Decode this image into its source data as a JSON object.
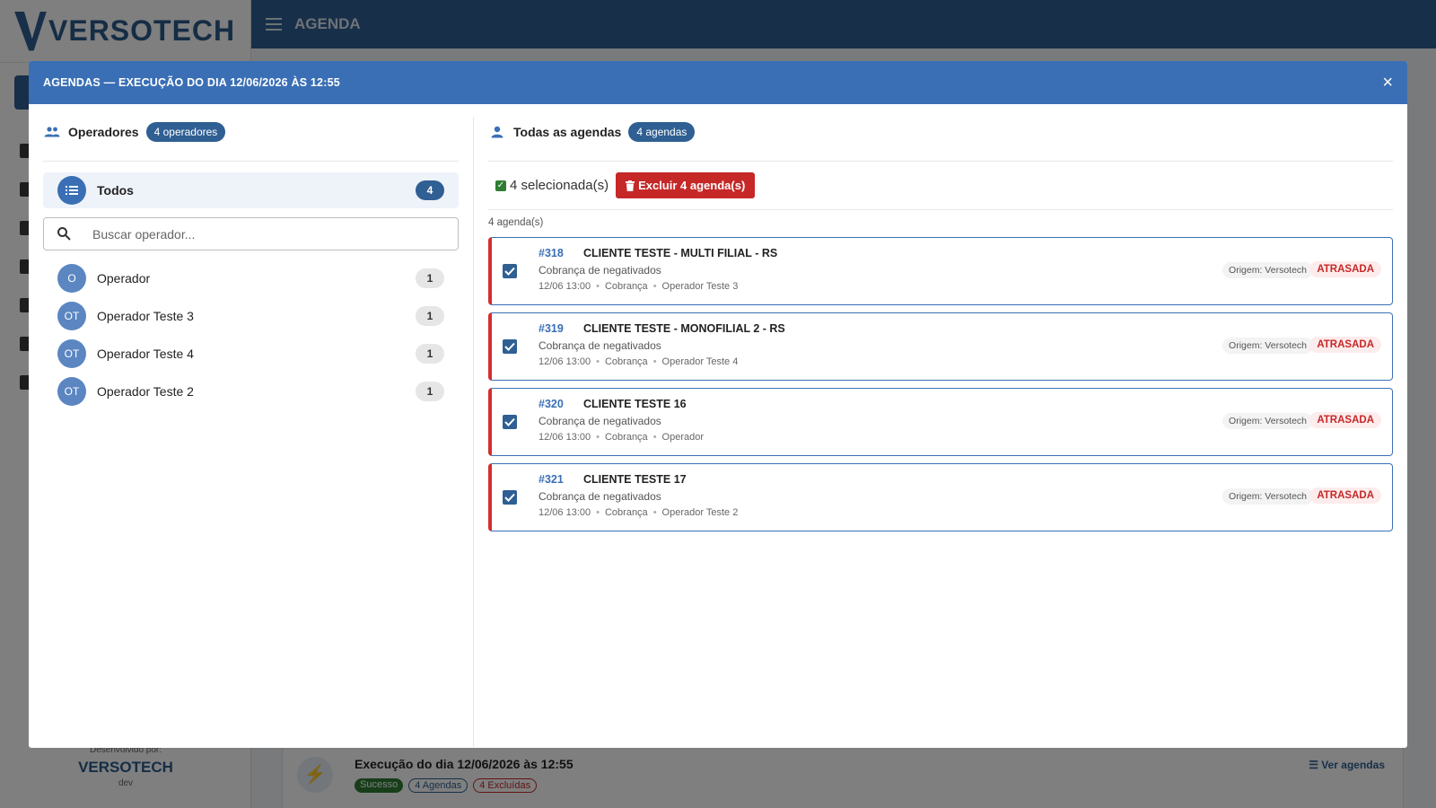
{
  "app": {
    "logo_text": "VERSOTECH",
    "topbar_title": "AGENDA",
    "footer_label": "Desenvolvido por:",
    "footer_logo": "VERSOTECH",
    "footer_env": "dev"
  },
  "background_card": {
    "title": "Execução do dia 12/06/2026 às 12:55",
    "badge_success": "Sucesso",
    "badge_agendas": "4 Agendas",
    "badge_excluidas": "4 Excluídas",
    "link_ver_agendas": "Ver agendas"
  },
  "modal": {
    "title": "AGENDAS — EXECUÇÃO DO DIA 12/06/2026 ÀS 12:55",
    "close_label": "×"
  },
  "operators_panel": {
    "title": "Operadores",
    "count_label": "4 operadores",
    "todos": {
      "label": "Todos",
      "count": "4"
    },
    "search_placeholder": "Buscar operador...",
    "items": [
      {
        "initials": "O",
        "name": "Operador",
        "count": "1"
      },
      {
        "initials": "OT",
        "name": "Operador Teste 3",
        "count": "1"
      },
      {
        "initials": "OT",
        "name": "Operador Teste 4",
        "count": "1"
      },
      {
        "initials": "OT",
        "name": "Operador Teste 2",
        "count": "1"
      }
    ]
  },
  "agendas_panel": {
    "title": "Todas as agendas",
    "count_label": "4 agendas",
    "selected_text": "4 selecionada(s)",
    "delete_button": "Excluir 4 agenda(s)",
    "list_count": "4 agenda(s)",
    "items": [
      {
        "id": "#318",
        "client": "CLIENTE TESTE - MULTI FILIAL - RS",
        "description": "Cobrança de negativados",
        "datetime": "12/06 13:00",
        "type": "Cobrança",
        "operator": "Operador Teste 3",
        "origin": "Origem: Versotech",
        "status": "ATRASADA",
        "checked": true
      },
      {
        "id": "#319",
        "client": "CLIENTE TESTE - MONOFILIAL 2 - RS",
        "description": "Cobrança de negativados",
        "datetime": "12/06 13:00",
        "type": "Cobrança",
        "operator": "Operador Teste 4",
        "origin": "Origem: Versotech",
        "status": "ATRASADA",
        "checked": true
      },
      {
        "id": "#320",
        "client": "CLIENTE TESTE 16",
        "description": "Cobrança de negativados",
        "datetime": "12/06 13:00",
        "type": "Cobrança",
        "operator": "Operador",
        "origin": "Origem: Versotech",
        "status": "ATRASADA",
        "checked": true
      },
      {
        "id": "#321",
        "client": "CLIENTE TESTE 17",
        "description": "Cobrança de negativados",
        "datetime": "12/06 13:00",
        "type": "Cobrança",
        "operator": "Operador Teste 2",
        "origin": "Origem: Versotech",
        "status": "ATRASADA",
        "checked": true
      }
    ]
  },
  "colors": {
    "primary": "#2f5f93",
    "modal_header": "#3a6fb5",
    "danger": "#c62828",
    "success": "#2e7d32"
  }
}
